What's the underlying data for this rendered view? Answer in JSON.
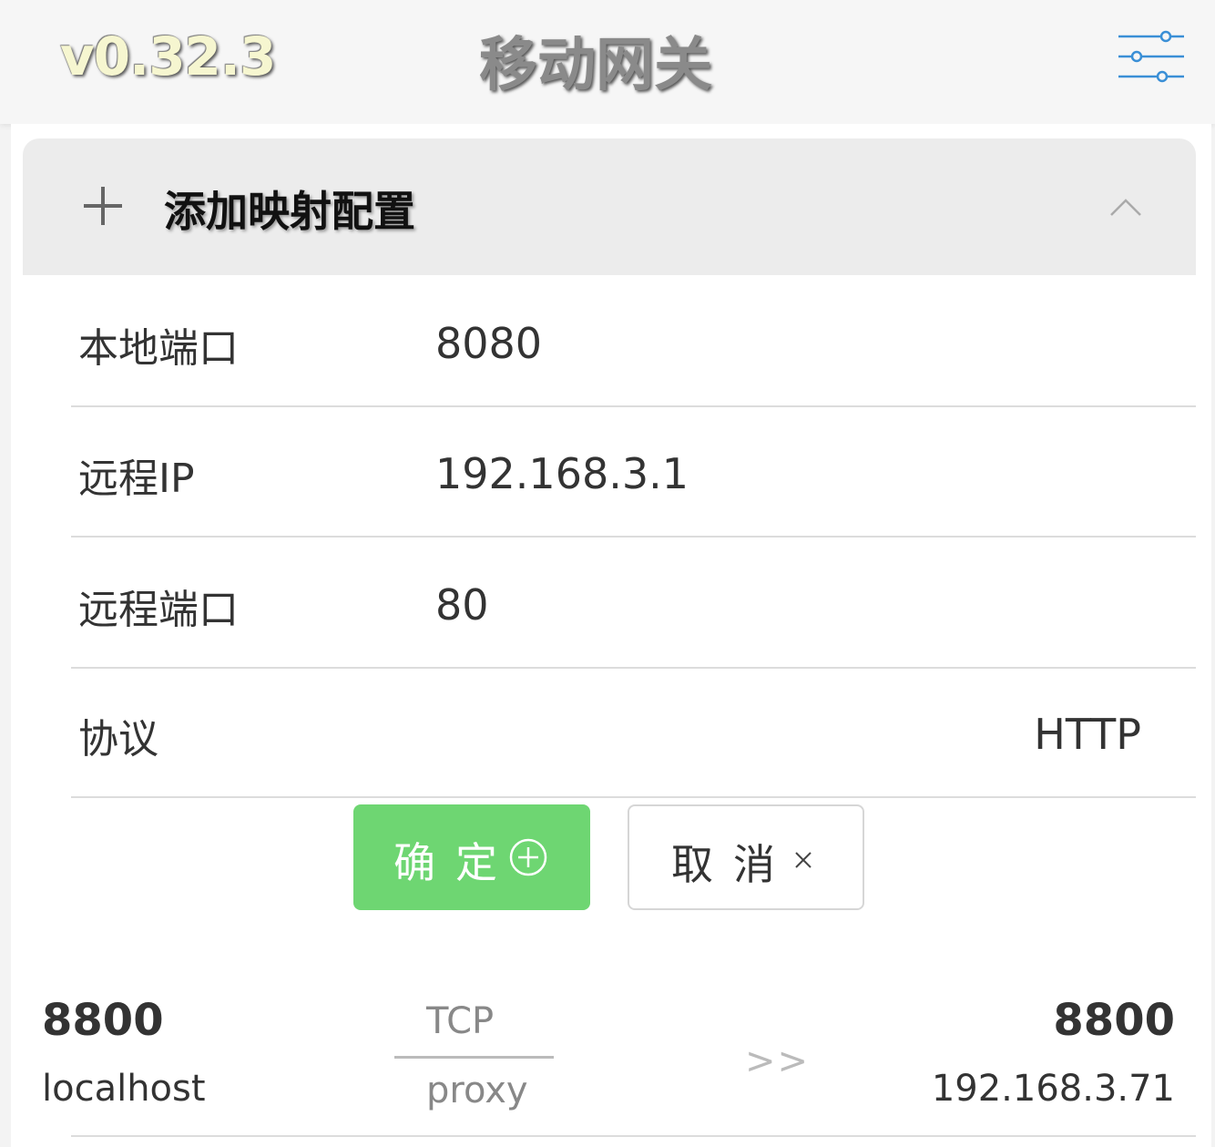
{
  "header": {
    "version": "v0.32.3",
    "title": "移动网关",
    "settings_icon": "sliders-icon"
  },
  "add_panel": {
    "title": "添加映射配置",
    "expanded": true,
    "fields": {
      "local_port": {
        "label": "本地端口",
        "value": "8080"
      },
      "remote_ip": {
        "label": "远程IP",
        "value": "192.168.3.1"
      },
      "remote_port": {
        "label": "远程端口",
        "value": "80"
      },
      "protocol": {
        "label": "协议",
        "value": "HTTP"
      }
    },
    "confirm_label": "确定",
    "cancel_label": "取消"
  },
  "mappings": [
    {
      "local_port": "8800",
      "local_host": "localhost",
      "protocol": "TCP",
      "type": "proxy",
      "arrow": ">>",
      "remote_port": "8800",
      "remote_host": "192.168.3.71"
    }
  ],
  "colors": {
    "confirm": "#6ed672",
    "accent_icon": "#3a8fd6"
  }
}
